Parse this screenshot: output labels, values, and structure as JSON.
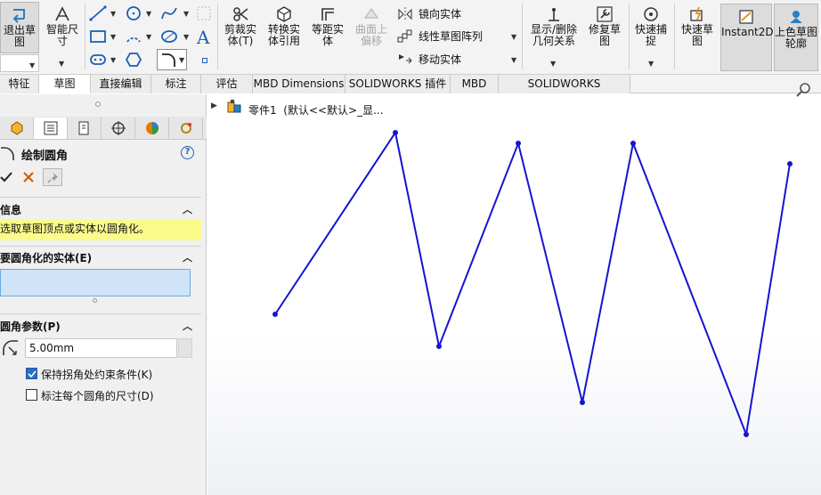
{
  "ribbon": {
    "exit_sketch": "退出草图",
    "smart_dimension": "智能尺寸",
    "trim": "剪裁实体(T)",
    "convert": "转换实体引用",
    "offset": "等距实体",
    "surface_offset": "曲面上偏移",
    "mirror": "镜向实体",
    "linear_pattern": "线性草图阵列",
    "move": "移动实体",
    "display_relations": "显示/删除几何关系",
    "repair": "修复草图",
    "quick_snap": "快速捕捉",
    "rapid_sketch": "快速草图",
    "instant2d": "Instant2D",
    "shaded_contours": "上色草图轮廓"
  },
  "tabs": [
    "特征",
    "草图",
    "直接编辑",
    "标注",
    "评估",
    "MBD Dimensions",
    "SOLIDWORKS 插件",
    "MBD",
    "SOLIDWORKS Inspection"
  ],
  "active_tab": "草图",
  "panel": {
    "title": "绘制圆角",
    "info_header": "信息",
    "info_message": "选取草图顶点或实体以圆角化。",
    "entities_header": "要圆角化的实体(E)",
    "params_header": "圆角参数(P)",
    "radius_value": "5.00mm",
    "keep_constraint_label": "保持拐角处约束条件(K)",
    "keep_constraint_checked": true,
    "dimension_each_label": "标注每个圆角的尺寸(D)",
    "dimension_each_checked": false
  },
  "tree": {
    "part_label": "零件1  (默认<<默认>_显..."
  },
  "sketch": {
    "line_color": "#1414d2",
    "vertex_count": 9
  },
  "colors": {
    "info_bg": "#fbfb8c",
    "selection_box_bg": "#cfe4f7"
  }
}
